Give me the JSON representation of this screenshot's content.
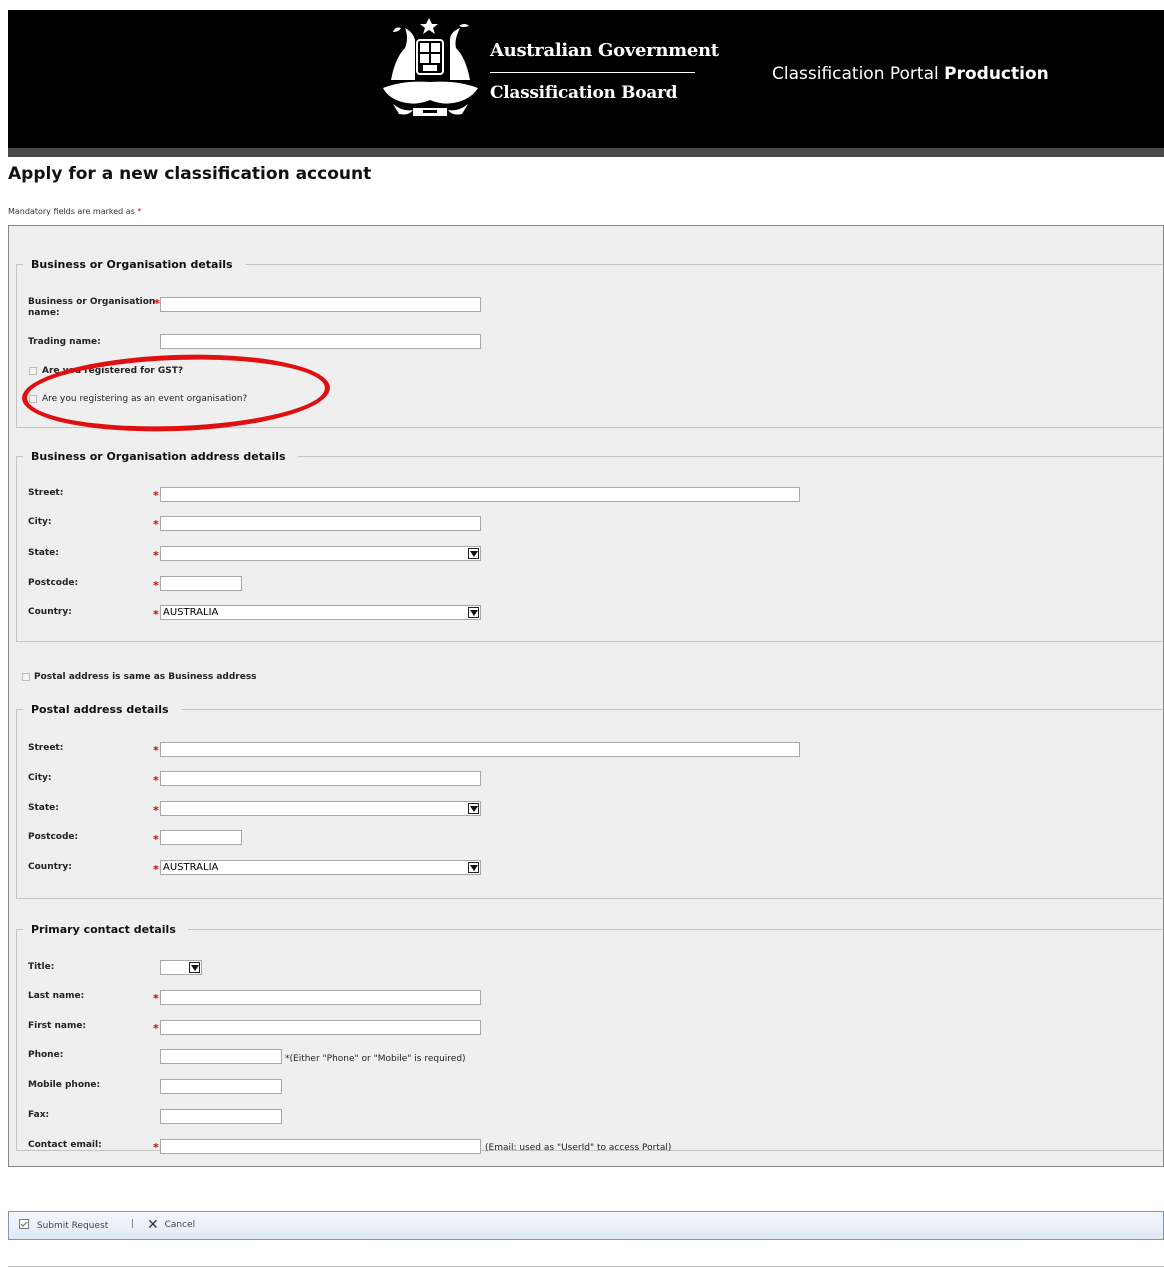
{
  "header": {
    "gov_name": "Australian Government",
    "board_name": "Classification Board",
    "portal_prefix": "Classification Portal",
    "portal_bold": "Production",
    "logo_icon": "commonwealth-coat-of-arms"
  },
  "page": {
    "title": "Apply for a new classification account",
    "mandatory_note": "Mandatory fields are marked as",
    "required_marker": "*"
  },
  "business": {
    "legend": "Business or Organisation details",
    "org_name_label": "Business or Organisation name:",
    "trading_label": "Trading name:",
    "gst_label": "Are you registered for GST?",
    "event_label": "Are you registering as an event organisation?"
  },
  "address": {
    "legend": "Business or Organisation address details",
    "street_label": "Street:",
    "city_label": "City:",
    "state_label": "State:",
    "postcode_label": "Postcode:",
    "country_label": "Country:",
    "country_value": "AUSTRALIA",
    "state_value": ""
  },
  "postal_same_label": "Postal address is same as Business address",
  "postal": {
    "legend": "Postal address details",
    "street_label": "Street:",
    "city_label": "City:",
    "state_label": "State:",
    "postcode_label": "Postcode:",
    "country_label": "Country:",
    "country_value": "AUSTRALIA",
    "state_value": ""
  },
  "contact": {
    "legend": "Primary contact details",
    "title_label": "Title:",
    "last_name_label": "Last name:",
    "first_name_label": "First name:",
    "phone_label": "Phone:",
    "phone_note": "*(Either \"Phone\" or \"Mobile\" is required)",
    "mobile_label": "Mobile phone:",
    "fax_label": "Fax:",
    "email_label": "Contact email:",
    "email_note": "(Email: used as \"UserId\" to access Portal)"
  },
  "toolbar": {
    "submit_label": "Submit Request",
    "separator": "|",
    "cancel_label": "Cancel"
  },
  "colors": {
    "header_bg": "#000000",
    "required": "#dd0000",
    "annotation_circle": "#e01010",
    "form_bg": "#efefef"
  }
}
